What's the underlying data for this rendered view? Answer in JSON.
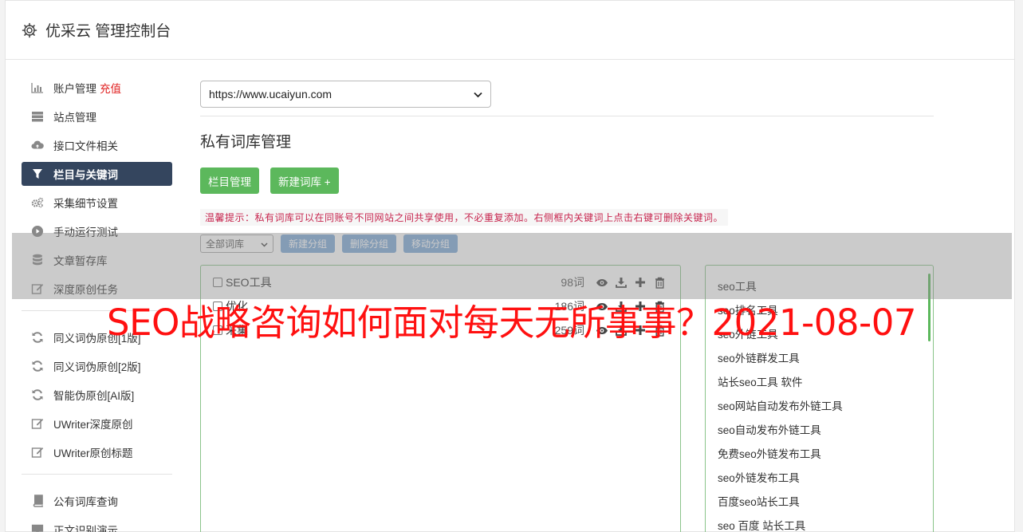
{
  "header": {
    "title": "优采云 管理控制台"
  },
  "sidebar": {
    "group1": [
      {
        "label": "账户管理",
        "extra": "充值",
        "icon": "bar-chart-icon"
      },
      {
        "label": "站点管理",
        "icon": "server-icon"
      },
      {
        "label": "接口文件相关",
        "icon": "cloud-upload-icon"
      },
      {
        "label": "栏目与关键词",
        "icon": "filter-icon",
        "active": true
      },
      {
        "label": "采集细节设置",
        "icon": "cogs-icon"
      },
      {
        "label": "手动运行测试",
        "icon": "play-circle-icon"
      },
      {
        "label": "文章暂存库",
        "icon": "database-icon"
      },
      {
        "label": "深度原创任务",
        "icon": "edit-icon"
      }
    ],
    "group2": [
      {
        "label": "同义词伪原创[1版]",
        "icon": "refresh-icon"
      },
      {
        "label": "同义词伪原创[2版]",
        "icon": "refresh-icon"
      },
      {
        "label": "智能伪原创[AI版]",
        "icon": "refresh-icon"
      },
      {
        "label": "UWriter深度原创",
        "icon": "edit-icon"
      },
      {
        "label": "UWriter原创标题",
        "icon": "edit-icon"
      }
    ],
    "group3": [
      {
        "label": "公有词库查询",
        "icon": "book-icon"
      },
      {
        "label": "正文识别演示",
        "icon": "monitor-icon"
      }
    ]
  },
  "main": {
    "site_select": "https://www.ucaiyun.com",
    "section_title": "私有词库管理",
    "buttons": {
      "columns": "栏目管理",
      "new_library": "新建词库 +"
    },
    "tip": "温馨提示：私有词库可以在同账号不同网站之间共享使用，不必重复添加。右侧框内关键词上点击右键可删除关键词。",
    "filter": {
      "select": "全部词库",
      "new_group": "新建分组",
      "delete_group": "删除分组",
      "move_group": "移动分组"
    },
    "groups": [
      {
        "name": "SEO工具",
        "count": "98词"
      },
      {
        "name": "优化",
        "count": "186词"
      },
      {
        "name": "采集",
        "count": "259词"
      }
    ],
    "keywords": [
      "seo工具",
      "seo排名工具",
      "seo外链工具",
      "seo外链群发工具",
      "站长seo工具 软件",
      "seo网站自动发布外链工具",
      "seo自动发布外链工具",
      "免费seo外链发布工具",
      "seo外链发布工具",
      "百度seo站长工具",
      "seo 百度 站长工具"
    ]
  },
  "overlay": {
    "title": "SEO战略咨询如何面对每天无所事事？2021-08-07"
  },
  "colors": {
    "accent_green": "#5cb85c",
    "sidebar_active": "#34455e",
    "tip_red": "#c7254e",
    "overlay_red": "#ff1010"
  }
}
